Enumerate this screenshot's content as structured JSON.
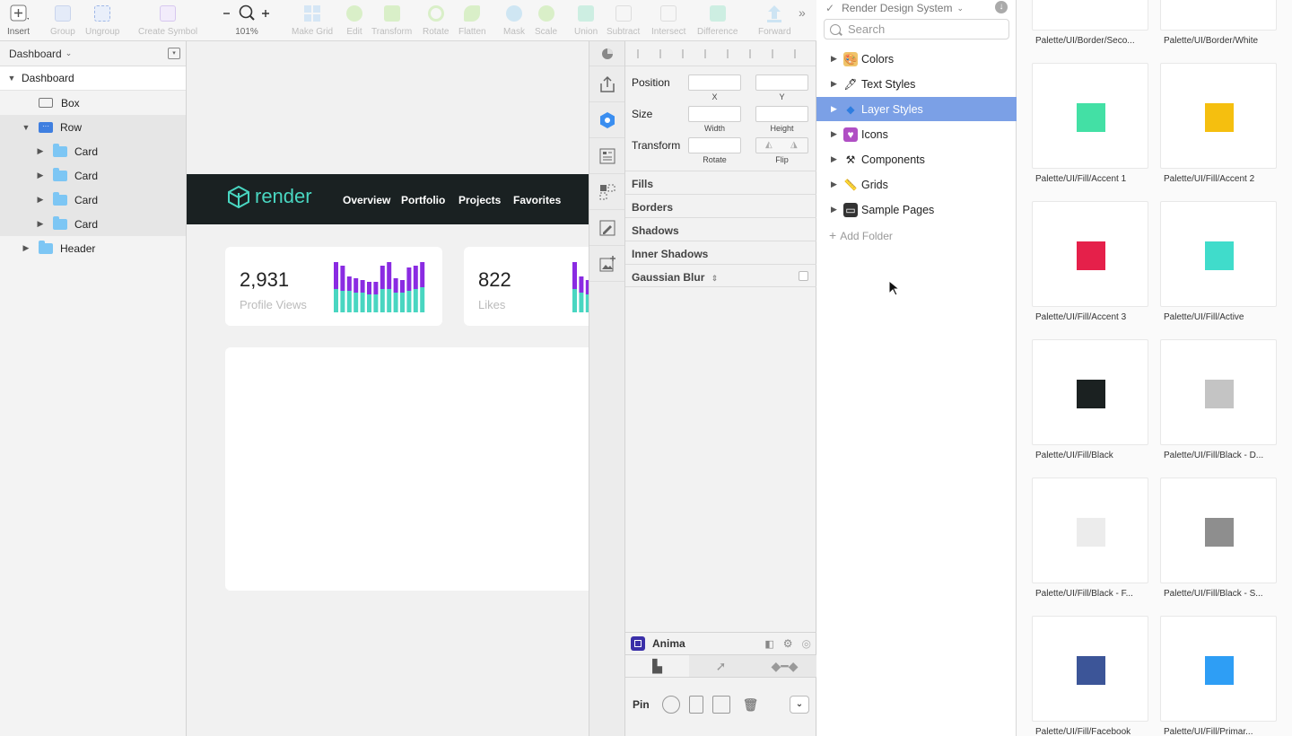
{
  "toolbar": {
    "insert": "Insert",
    "group": "Group",
    "ungroup": "Ungroup",
    "create_symbol": "Create Symbol",
    "zoom": "101%",
    "make_grid": "Make Grid",
    "edit": "Edit",
    "transform": "Transform",
    "rotate": "Rotate",
    "flatten": "Flatten",
    "mask": "Mask",
    "scale": "Scale",
    "union": "Union",
    "subtract": "Subtract",
    "intersect": "Intersect",
    "difference": "Difference",
    "forward": "Forward"
  },
  "layers": {
    "page": "Dashboard",
    "items": [
      "Dashboard",
      "Box",
      "Row",
      "Card",
      "Card",
      "Card",
      "Card",
      "Header"
    ]
  },
  "canvas": {
    "brand": "render",
    "nav": [
      "Overview",
      "Portfolio",
      "Projects",
      "Favorites"
    ],
    "stats": [
      {
        "value": "2,931",
        "label": "Profile Views"
      },
      {
        "value": "822",
        "label": "Likes"
      }
    ],
    "mini_chart": {
      "purple_color": "#8a2be2",
      "teal_color": "#49d6c1",
      "bars_1": [
        [
          56,
          26
        ],
        [
          52,
          24
        ],
        [
          40,
          24
        ],
        [
          38,
          22
        ],
        [
          36,
          22
        ],
        [
          34,
          20
        ],
        [
          34,
          20
        ],
        [
          52,
          26
        ],
        [
          56,
          26
        ],
        [
          38,
          22
        ],
        [
          36,
          22
        ],
        [
          50,
          24
        ],
        [
          52,
          26
        ],
        [
          56,
          28
        ]
      ],
      "bars_2": [
        [
          56,
          26
        ],
        [
          40,
          22
        ],
        [
          36,
          20
        ]
      ]
    }
  },
  "inspector": {
    "position": "Position",
    "x": "X",
    "y": "Y",
    "size": "Size",
    "width": "Width",
    "height": "Height",
    "transform": "Transform",
    "rotate": "Rotate",
    "flip": "Flip",
    "sections": [
      "Fills",
      "Borders",
      "Shadows",
      "Inner Shadows",
      "Gaussian Blur"
    ],
    "anima_title": "Anima",
    "pin": "Pin"
  },
  "library": {
    "title": "Render Design System",
    "search_placeholder": "Search",
    "items": [
      "Colors",
      "Text Styles",
      "Layer Styles",
      "Icons",
      "Components",
      "Grids",
      "Sample Pages"
    ],
    "add_folder": "Add Folder"
  },
  "swatches": {
    "top_labels": [
      "Palette/UI/Border/Seco...",
      "Palette/UI/Border/White"
    ],
    "items": [
      {
        "label": "Palette/UI/Fill/Accent 1",
        "color": "#43e0a5"
      },
      {
        "label": "Palette/UI/Fill/Accent 2",
        "color": "#f5bf0f"
      },
      {
        "label": "Palette/UI/Fill/Accent 3",
        "color": "#e5204a"
      },
      {
        "label": "Palette/UI/Fill/Active",
        "color": "#40dccb"
      },
      {
        "label": "Palette/UI/Fill/Black",
        "color": "#1b2121"
      },
      {
        "label": "Palette/UI/Fill/Black - D...",
        "color": "#c4c4c4"
      },
      {
        "label": "Palette/UI/Fill/Black - F...",
        "color": "#ececec"
      },
      {
        "label": "Palette/UI/Fill/Black - S...",
        "color": "#8e8e8e"
      },
      {
        "label": "Palette/UI/Fill/Facebook",
        "color": "#3c5598"
      },
      {
        "label": "Palette/UI/Fill/Primar...",
        "color": "#2e9ef5"
      }
    ]
  }
}
